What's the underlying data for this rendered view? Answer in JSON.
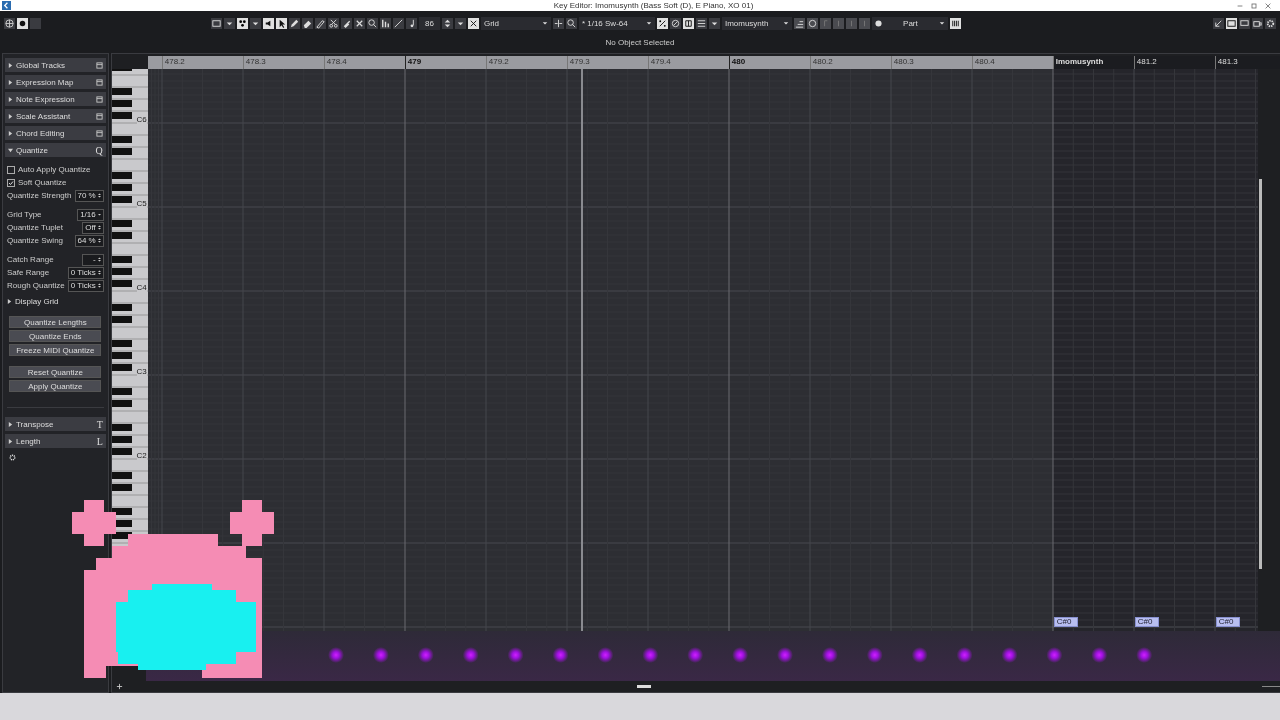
{
  "window": {
    "title": "Key Editor: Imomusynth (Bass Soft (D), E Piano, XO 01)"
  },
  "toolbar": {
    "velocity": "86",
    "snap_mode": "Grid",
    "quantize": "* 1/16  Sw-64",
    "instrument": "Imomusynth",
    "color_mode": "Part"
  },
  "info_line": "No Object Selected",
  "inspector": {
    "sections": [
      {
        "label": "Global Tracks",
        "expanded": false
      },
      {
        "label": "Expression Map",
        "expanded": false
      },
      {
        "label": "Note Expression",
        "expanded": false
      },
      {
        "label": "Scale Assistant",
        "expanded": false
      },
      {
        "label": "Chord Editing",
        "expanded": false
      },
      {
        "label": "Quantize",
        "expanded": true,
        "icon": "Q"
      }
    ],
    "quantize": {
      "option_groups": [
        [
          {
            "kind": "checkbox",
            "label": "Auto Apply Quantize",
            "checked": false
          },
          {
            "kind": "checkbox",
            "label": "Soft Quantize",
            "checked": true
          },
          {
            "kind": "spinner",
            "label": "Quantize Strength",
            "value": "70 %"
          }
        ],
        [
          {
            "kind": "dropdown",
            "label": "Grid Type",
            "value": "1/16"
          },
          {
            "kind": "spinner",
            "label": "Quantize Tuplet",
            "value": "Off"
          },
          {
            "kind": "spinner",
            "label": "Quantize Swing",
            "value": "64 %"
          }
        ],
        [
          {
            "kind": "spinner",
            "label": "Catch Range",
            "value": "-"
          },
          {
            "kind": "spinner",
            "label": "Safe Range",
            "value": "0 Ticks"
          },
          {
            "kind": "spinner",
            "label": "Rough Quantize",
            "value": "0 Ticks"
          }
        ]
      ],
      "display_grid": {
        "label": "Display Grid",
        "expanded": false
      },
      "button_groups": [
        [
          "Quantize Lengths",
          "Quantize Ends",
          "Freeze MIDI Quantize"
        ],
        [
          "Reset Quantize",
          "Apply Quantize"
        ]
      ]
    },
    "lower_sections": [
      {
        "label": "Transpose",
        "expanded": false,
        "icon": "T"
      },
      {
        "label": "Length",
        "expanded": false,
        "icon": "L"
      }
    ]
  },
  "ruler": {
    "labels": [
      {
        "text": "478.2",
        "kind": "beat"
      },
      {
        "text": "478.3",
        "kind": "beat"
      },
      {
        "text": "478.4",
        "kind": "beat"
      },
      {
        "text": "479",
        "kind": "bar"
      },
      {
        "text": "479.2",
        "kind": "beat"
      },
      {
        "text": "479.3",
        "kind": "beat"
      },
      {
        "text": "479.4",
        "kind": "beat"
      },
      {
        "text": "480",
        "kind": "bar"
      },
      {
        "text": "480.2",
        "kind": "beat"
      },
      {
        "text": "480.3",
        "kind": "beat"
      },
      {
        "text": "480.4",
        "kind": "beat"
      },
      {
        "text": "Imomusynth",
        "kind": "part"
      },
      {
        "text": "481.2",
        "kind": "beat"
      },
      {
        "text": "481.3",
        "kind": "beat"
      }
    ]
  },
  "keyboard": {
    "octave_labels": [
      "C6",
      "C5",
      "C4",
      "C3",
      "C2"
    ]
  },
  "zoom": {
    "level": 0.7
  },
  "notes": [
    {
      "label": "C#0"
    },
    {
      "label": "C#0"
    },
    {
      "label": "C#0"
    }
  ]
}
